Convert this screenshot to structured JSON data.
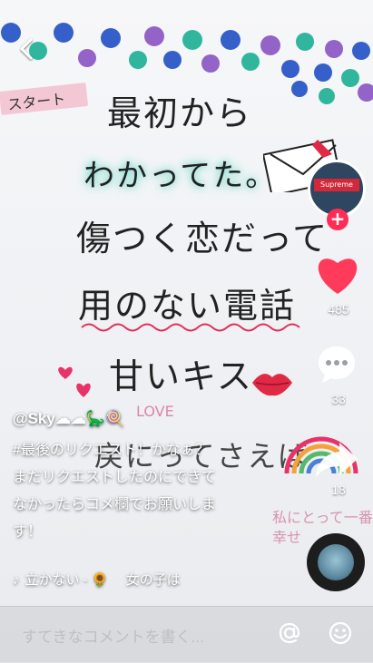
{
  "video": {
    "sticker_start": "スタート",
    "lines": [
      "最初から",
      "わかってた。",
      "傷つく恋だって",
      "用のない電話",
      "甘いキス",
      "戻にってさえば"
    ],
    "faint_love": "LOVE",
    "faint_bottom": "私にとって一番\n幸せ"
  },
  "sidebar": {
    "avatar_text": "Supreme",
    "like_count": "485",
    "comment_count": "33",
    "share_count": "18"
  },
  "caption": {
    "username": "@Sky☁☁🦕🍭",
    "text_lines": [
      "#最後のリクエスト！かなぁ？",
      "まだリクエストしたのにできて",
      "なかったらコメ欄でお願いしま",
      "す！"
    ]
  },
  "music": {
    "title": "立かない - 🌻　 女の子は"
  },
  "comment_bar": {
    "placeholder": "すてきなコメントを書く..."
  },
  "colors": {
    "accent": "#ff2d55",
    "like": "#ff3b5c"
  }
}
